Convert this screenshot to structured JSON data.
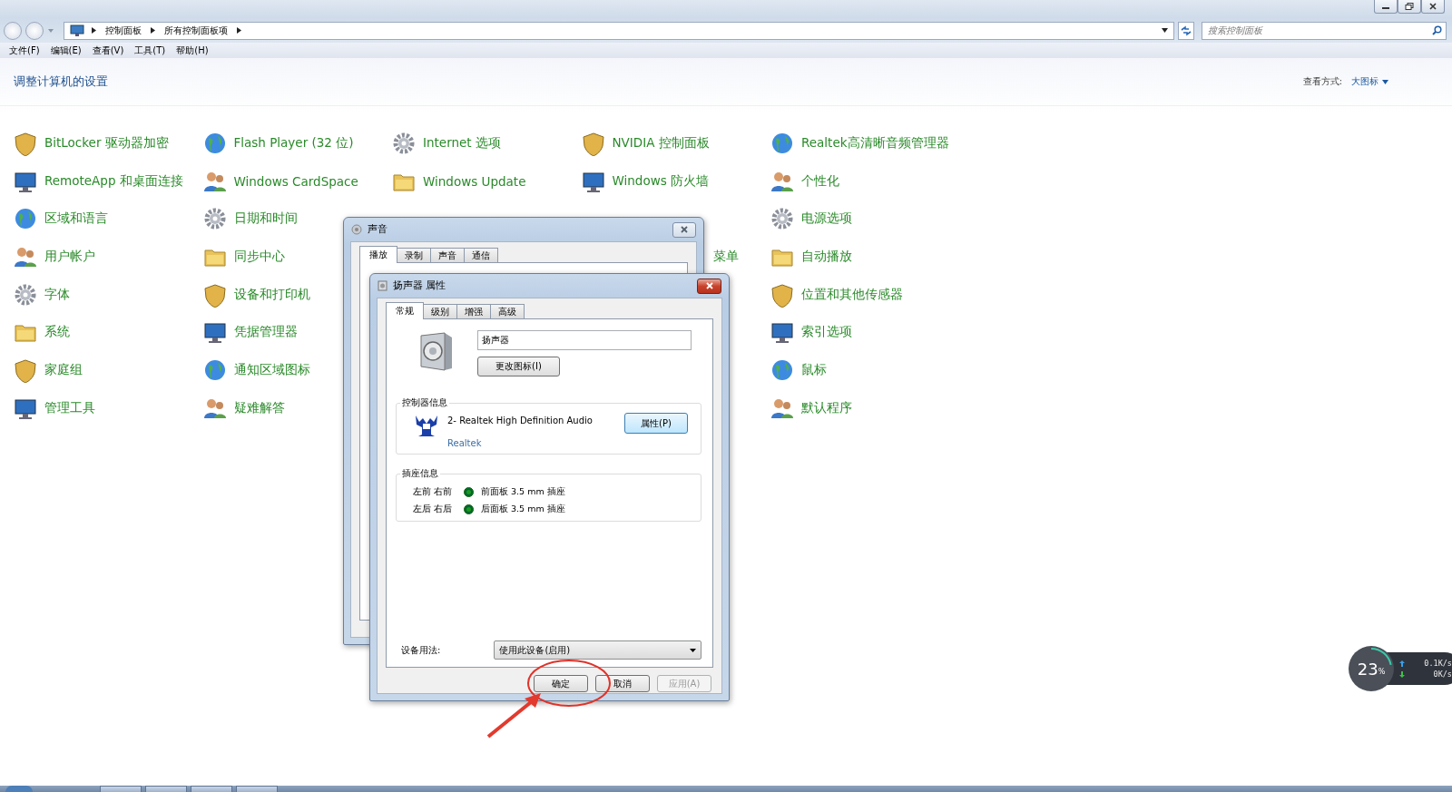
{
  "window": {
    "breadcrumb": [
      "控制面板",
      "所有控制面板项"
    ],
    "search": {
      "placeholder": "搜索控制面板"
    }
  },
  "menu": [
    "文件(F)",
    "编辑(E)",
    "查看(V)",
    "工具(T)",
    "帮助(H)"
  ],
  "heading": "调整计算机的设置",
  "view": {
    "label": "查看方式:",
    "value": "大图标"
  },
  "columns": [
    {
      "items": [
        {
          "label": "BitLocker 驱动器加密",
          "kind": "applet"
        },
        {
          "label": "RemoteApp 和桌面连接",
          "kind": "applet"
        },
        {
          "label": "区域和语言",
          "kind": "applet"
        },
        {
          "label": "用户帐户",
          "kind": "applet"
        },
        {
          "label": "字体",
          "kind": "applet"
        },
        {
          "label": "系统",
          "kind": "applet"
        },
        {
          "label": "家庭组",
          "kind": "applet"
        },
        {
          "label": "管理工具",
          "kind": "applet"
        }
      ]
    },
    {
      "items": [
        {
          "label": "Flash Player (32 位)",
          "kind": "applet"
        },
        {
          "label": "Windows CardSpace",
          "kind": "applet"
        },
        {
          "label": "日期和时间",
          "kind": "applet"
        },
        {
          "label": "同步中心",
          "kind": "applet"
        },
        {
          "label": "设备和打印机",
          "kind": "applet"
        },
        {
          "label": "凭据管理器",
          "kind": "applet"
        },
        {
          "label": "通知区域图标",
          "kind": "applet"
        },
        {
          "label": "疑难解答",
          "kind": "applet"
        }
      ]
    },
    {
      "items": [
        {
          "label": "Internet 选项",
          "kind": "applet"
        },
        {
          "label": "Windows Update",
          "kind": "applet"
        }
      ]
    },
    {
      "items": [
        {
          "label": "NVIDIA 控制面板",
          "kind": "applet"
        },
        {
          "label": "Windows 防火墙",
          "kind": "applet"
        },
        {
          "label": "菜单",
          "kind": "partial"
        }
      ]
    },
    {
      "items": [
        {
          "label": "Realtek高清晰音频管理器",
          "kind": "applet"
        },
        {
          "label": "个性化",
          "kind": "applet"
        },
        {
          "label": "电源选项",
          "kind": "applet"
        },
        {
          "label": "自动播放",
          "kind": "applet"
        },
        {
          "label": "位置和其他传感器",
          "kind": "applet"
        },
        {
          "label": "索引选项",
          "kind": "applet"
        },
        {
          "label": "鼠标",
          "kind": "applet"
        },
        {
          "label": "默认程序",
          "kind": "applet"
        }
      ]
    }
  ],
  "sound_dialog": {
    "title": "声音",
    "tabs": [
      {
        "label": "播放",
        "selected": true
      },
      {
        "label": "录制",
        "selected": false
      },
      {
        "label": "声音",
        "selected": false
      },
      {
        "label": "通信",
        "selected": false
      }
    ]
  },
  "properties_dialog": {
    "title": "扬声器 属性",
    "tabs": [
      {
        "label": "常规",
        "selected": true
      },
      {
        "label": "级别",
        "selected": false
      },
      {
        "label": "增强",
        "selected": false
      },
      {
        "label": "高级",
        "selected": false
      }
    ],
    "name_field": "扬声器",
    "change_icon_button": "更改图标(I)",
    "controller": {
      "title": "控制器信息",
      "device": "2- Realtek High Definition Audio",
      "vendor": "Realtek",
      "button": "属性(P)"
    },
    "jacks": {
      "title": "插座信息",
      "rows": [
        {
          "channels": "左前 右前",
          "jack": "前面板 3.5 mm 插座"
        },
        {
          "channels": "左后 右后",
          "jack": "后面板 3.5 mm 插座"
        }
      ]
    },
    "usage": {
      "label": "设备用法:",
      "value": "使用此设备(启用)"
    },
    "buttons": [
      {
        "label": "确定",
        "disabled": false
      },
      {
        "label": "取消",
        "disabled": false
      },
      {
        "label": "应用(A)",
        "disabled": true
      }
    ]
  },
  "gadget": {
    "value": "23",
    "unit": "%",
    "upload": "0.1K/s",
    "download": "0K/s"
  }
}
